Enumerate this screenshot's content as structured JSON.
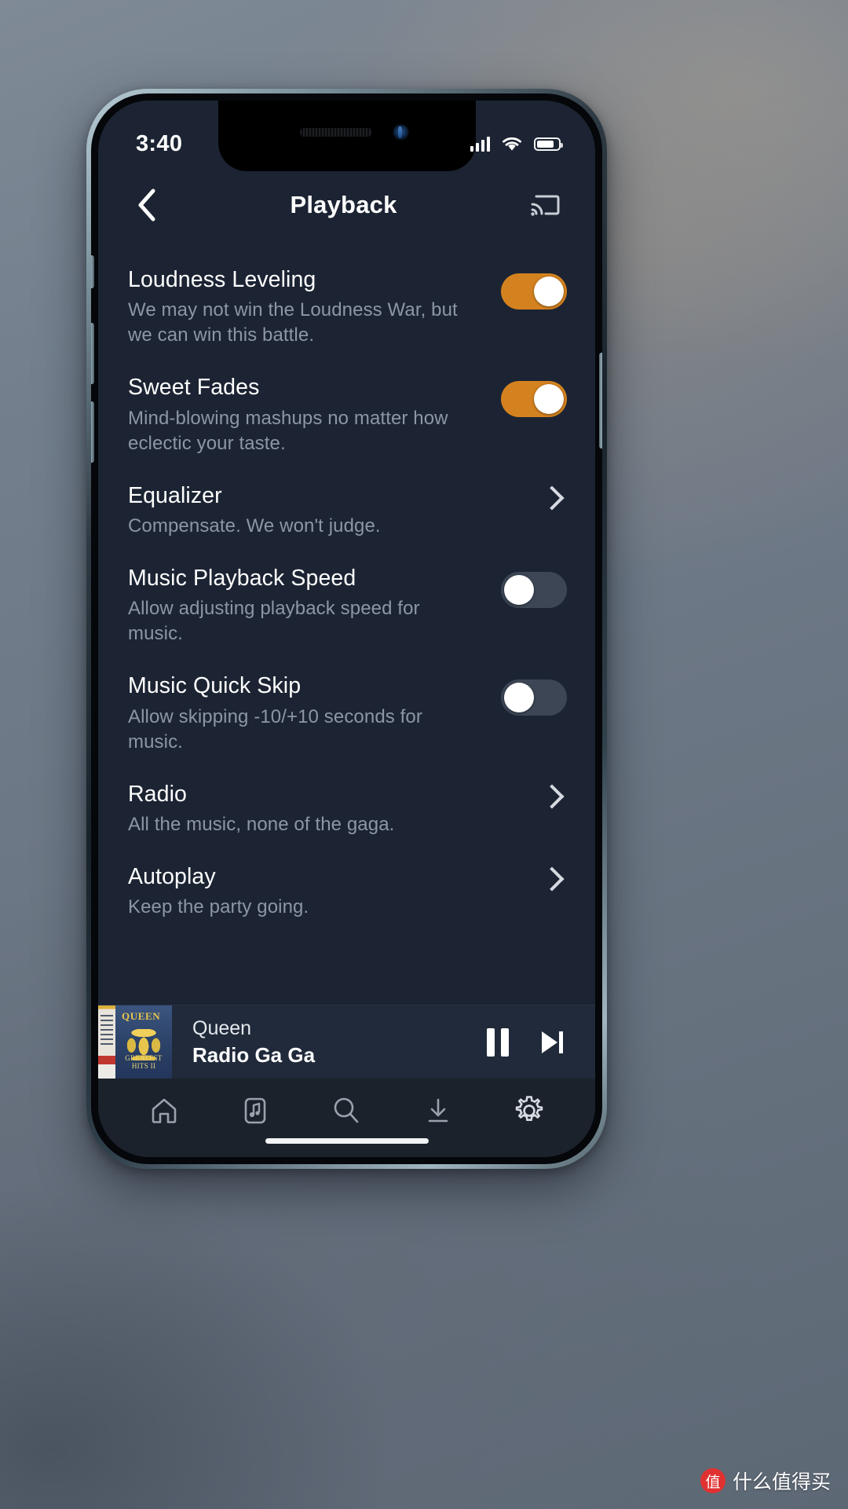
{
  "status_bar": {
    "time": "3:40",
    "signal_icon": "cellular-signal-icon",
    "wifi_icon": "wifi-icon",
    "battery_icon": "battery-icon"
  },
  "header": {
    "back_icon": "back-chevron-icon",
    "title": "Playback",
    "cast_icon": "chromecast-icon"
  },
  "settings": [
    {
      "title": "Loudness Leveling",
      "description": "We may not win the Loudness War, but we can win this battle.",
      "control": "toggle",
      "value": "on"
    },
    {
      "title": "Sweet Fades",
      "description": "Mind-blowing mashups no matter how eclectic your taste.",
      "control": "toggle",
      "value": "on"
    },
    {
      "title": "Equalizer",
      "description": "Compensate. We won't judge.",
      "control": "chevron",
      "value": ""
    },
    {
      "title": "Music Playback Speed",
      "description": "Allow adjusting playback speed for music.",
      "control": "toggle",
      "value": "off"
    },
    {
      "title": "Music Quick Skip",
      "description": "Allow skipping -10/+10 seconds for music.",
      "control": "toggle",
      "value": "off"
    },
    {
      "title": "Radio",
      "description": "All the music, none of the gaga.",
      "control": "chevron",
      "value": ""
    },
    {
      "title": "Autoplay",
      "description": "Keep the party going.",
      "control": "chevron",
      "value": ""
    }
  ],
  "now_playing": {
    "artist": "Queen",
    "track": "Radio Ga Ga",
    "album_art_label": "QUEEN",
    "album_art_sublabel": "GREATEST HITS II",
    "pause_icon": "pause-icon",
    "next_icon": "skip-next-icon"
  },
  "bottom_nav": [
    {
      "icon": "home-icon",
      "label": "Home"
    },
    {
      "icon": "library-music-icon",
      "label": "Library"
    },
    {
      "icon": "search-icon",
      "label": "Search"
    },
    {
      "icon": "download-icon",
      "label": "Downloads"
    },
    {
      "icon": "gear-icon",
      "label": "Settings"
    }
  ],
  "watermark": {
    "badge": "值",
    "text": "什么值得买"
  },
  "colors": {
    "accent": "#d4821f",
    "screen_bg": "#1c2433",
    "nav_bg": "#1b222c",
    "player_bg": "#202a3a",
    "toggle_off": "#3c4655",
    "title_text": "#ffffff",
    "desc_text": "#8d96a4"
  }
}
